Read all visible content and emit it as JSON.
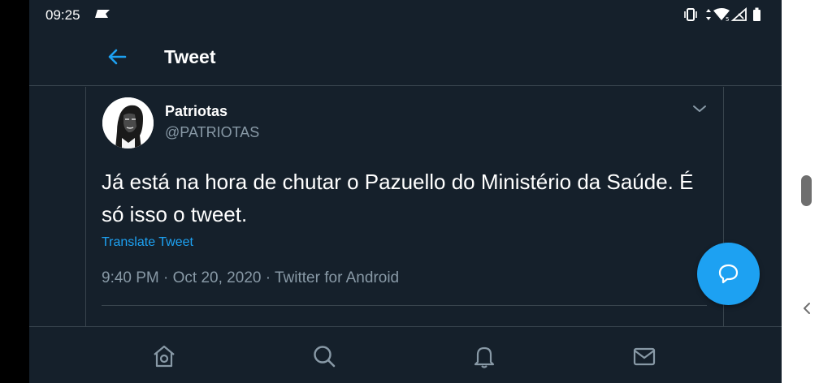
{
  "status_bar": {
    "time": "09:25"
  },
  "header": {
    "title": "Tweet",
    "back_icon": "arrow-left-icon"
  },
  "tweet": {
    "author_name": "Patriotas",
    "author_handle": "@PATRIOTAS",
    "text": "Já está na hora de chutar o Pazuello do Ministério da Saúde. É só isso o tweet.",
    "translate_label": "Translate Tweet",
    "time": "9:40 PM",
    "date": "Oct 20, 2020",
    "source": "Twitter for Android",
    "separator": "·"
  },
  "fab": {
    "icon": "reply-bubble-icon"
  },
  "bottom_nav": {
    "items": [
      "home-icon",
      "search-icon",
      "bell-icon",
      "mail-icon"
    ]
  },
  "colors": {
    "background": "#15202b",
    "accent": "#1da1f2",
    "secondary_text": "#8899a6",
    "divider": "#38444d"
  }
}
